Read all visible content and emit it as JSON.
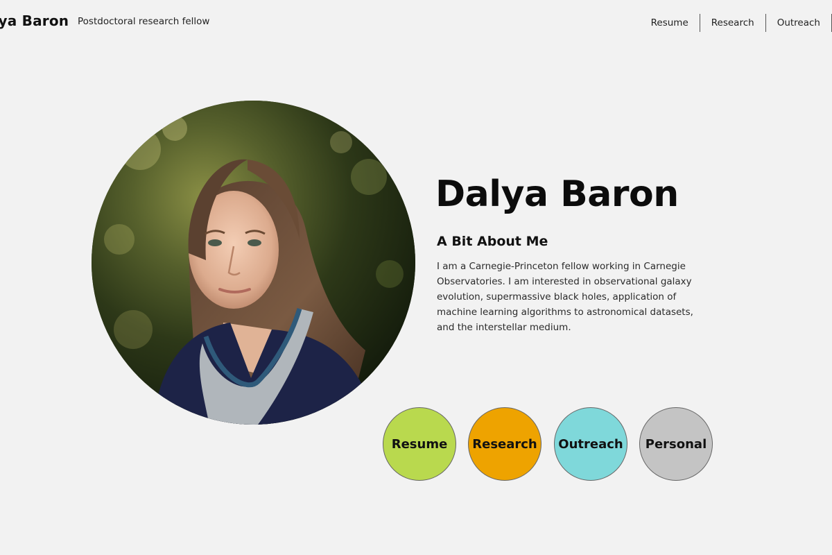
{
  "header": {
    "site_title": "Dalya Baron",
    "tagline": "Postdoctoral research fellow",
    "nav": [
      {
        "label": "Resume"
      },
      {
        "label": "Research"
      },
      {
        "label": "Outreach"
      }
    ]
  },
  "profile": {
    "photo_icon": "portrait-photo",
    "name": "Dalya Baron",
    "about_heading": "A Bit About Me",
    "about_text": "I am a Carnegie-Princeton fellow working in Carnegie Observatories. I am interested in observational galaxy evolution, supermassive black holes, application of machine learning algorithms to astronomical datasets, and the interstellar medium."
  },
  "bubbles": [
    {
      "label": "Resume",
      "color": "#b9d94e"
    },
    {
      "label": "Research",
      "color": "#eea300"
    },
    {
      "label": "Outreach",
      "color": "#7fd8da"
    },
    {
      "label": "Personal",
      "color": "#c4c4c4"
    }
  ],
  "colors": {
    "background": "#f2f2f2",
    "text": "#111111"
  }
}
